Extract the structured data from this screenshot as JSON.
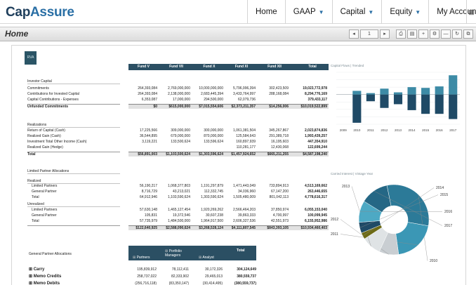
{
  "app": {
    "logo_cap": "Cap",
    "logo_assure": "Assure",
    "nav": [
      {
        "label": "Home",
        "caret": false
      },
      {
        "label": "GAAP",
        "caret": true
      },
      {
        "label": "Capital",
        "caret": true
      },
      {
        "label": "Equity",
        "caret": true
      },
      {
        "label": "My Account",
        "caret": false
      }
    ],
    "page_title": "Home",
    "page_number": "1",
    "badge": "RVA"
  },
  "table": {
    "columns": [
      "Fund V",
      "Fund VII",
      "Fund X",
      "Fund XI",
      "Fund XII",
      "Total"
    ],
    "sections": {
      "investor_capital": "Investor Capital",
      "realizations": "Realizations",
      "lp_allocations": "Limited Partner Allocations",
      "realized": "Realized",
      "unrealized": "Unrealized",
      "gp_allocations": "General Partner Allocations"
    },
    "rows": [
      {
        "label": "Commitments",
        "bold": false,
        "values": [
          "264,393,084",
          "2,769,000,000",
          "10,000,000,000",
          "5,796,996,394",
          "302,423,509",
          "19,023,772,978"
        ]
      },
      {
        "label": "Contributions for Invested Capital",
        "bold": false,
        "values": [
          "264,393,084",
          "2,138,000,000",
          "2,683,445,394",
          "3,433,764,997",
          "288,168,084",
          "8,294,776,169"
        ]
      },
      {
        "label": "Capital Contributions - Expenses",
        "bold": false,
        "values": [
          "6,353,087",
          "17,000,000",
          "294,500,000",
          "62,079,736",
          "",
          "379,433,117"
        ]
      },
      {
        "label": "Unfunded Commitments",
        "bold": true,
        "values": [
          "$0",
          "$615,000,000",
          "$7,015,554,606",
          "$2,373,211,357",
          "$14,256,006",
          "$10,019,522,899"
        ]
      },
      {
        "label": "Return of Capital (Cash)",
        "bold": false,
        "values": [
          "17,225,566",
          "309,000,000",
          "300,000,000",
          "1,061,381,504",
          "345,267,867",
          "2,023,874,836"
        ]
      },
      {
        "label": "Realized Gain (Cash)",
        "bold": false,
        "values": [
          "36,544,895",
          "679,000,000",
          "870,000,000",
          "125,584,643",
          "291,389,718",
          "1,993,439,257"
        ]
      },
      {
        "label": "Investment Total Other Income (Cash)",
        "bold": false,
        "values": [
          "3,119,221",
          "133,500,624",
          "133,596,624",
          "160,897,939",
          "16,195,603",
          "447,354,910"
        ]
      },
      {
        "label": "Realized Gain (Hedge)",
        "bold": false,
        "values": [
          "",
          "",
          "",
          "110,281,177",
          "12,430,068",
          "122,699,244"
        ]
      },
      {
        "label": "Total",
        "bold": true,
        "values": [
          "$56,891,003",
          "$1,103,500,624",
          "$1,303,596,624",
          "$1,457,924,652",
          "$665,211,255",
          "$4,587,198,240"
        ]
      },
      {
        "label": "Limited Partners",
        "bold": false,
        "values": [
          "56,190,217",
          "1,068,377,803",
          "1,191,297,879",
          "1,471,443,049",
          "733,894,913",
          "4,513,169,662"
        ]
      },
      {
        "label": "General Partner",
        "bold": false,
        "values": [
          "8,716,729",
          "43,213,021",
          "112,332,745",
          "34,036,960",
          "67,147,200",
          "263,446,655"
        ]
      },
      {
        "label": "Total",
        "bold": false,
        "values": [
          "64,912,946",
          "1,103,590,624",
          "1,303,590,624",
          "1,505,480,009",
          "801,042,113",
          "4,778,616,317"
        ]
      },
      {
        "label": "Limited Partners",
        "bold": false,
        "values": [
          "57,630,148",
          "1,465,127,454",
          "1,920,269,262",
          "2,566,464,203",
          "37,850,974",
          "6,055,153,040"
        ]
      },
      {
        "label": "General Partner",
        "bold": false,
        "values": [
          "105,831",
          "19,372,546",
          "30,607,238",
          "39,863,333",
          "4,700,997",
          "100,099,945"
        ]
      },
      {
        "label": "Total",
        "bold": false,
        "values": [
          "57,735,979",
          "1,484,500,000",
          "1,964,917,500",
          "2,606,327,536",
          "42,551,973",
          "6,155,952,986"
        ]
      },
      {
        "label": "",
        "bold": true,
        "values": [
          "$122,640,925",
          "$2,588,090,624",
          "$3,268,528,124",
          "$4,111,807,545",
          "$843,393,105",
          "$10,934,460,403"
        ]
      }
    ]
  },
  "gp_table": {
    "headers": [
      "Partners",
      "Portfolio Managers",
      "Analyst",
      "Total"
    ],
    "rows": [
      {
        "label": "Carry",
        "values": [
          "195,839,912",
          "78,112,411",
          "30,172,326",
          "304,124,649"
        ]
      },
      {
        "label": "Memo Credits",
        "values": [
          "258,737,022",
          "82,333,902",
          "29,465,013",
          "380,559,737"
        ]
      },
      {
        "label": "Memo Debits",
        "values": [
          "(256,716,118)",
          "(83,350,147)",
          "(30,414,495)",
          "(380,559,737)"
        ]
      }
    ]
  },
  "bar_chart_title": "Capital Flows | Trended",
  "donut_chart_title": "Carried Interest | Vintage Year",
  "chart_data": [
    {
      "type": "bar",
      "categories": [
        "2009",
        "2010",
        "2011",
        "2012",
        "2013",
        "2014",
        "2015",
        "2016",
        "2017"
      ],
      "series": [
        {
          "values": [
            0,
            0.5,
            0.2,
            0.8,
            0.3,
            1.0,
            0.9,
            1.1,
            2.6
          ]
        },
        {
          "values": [
            0,
            -3.8,
            -0.9,
            -1.8,
            -1.3,
            -2.1,
            -2.6,
            -2.6,
            -3.3
          ]
        }
      ],
      "colors": [
        "#3d8ba6",
        "#1f4a66"
      ],
      "grid": true
    },
    {
      "type": "pie",
      "labels": [
        "2010",
        "2011",
        "2012",
        "2013",
        "2014",
        "2015",
        "2016",
        "2017"
      ],
      "values": [
        31,
        20,
        9,
        9,
        3,
        5,
        10,
        13
      ],
      "colors": [
        "#2c7a98",
        "#3b97b5",
        "#c9ced2",
        "#dfe3e5",
        "#6d6a16",
        "#1f4a66",
        "#4da9c4",
        "#256785"
      ]
    }
  ]
}
